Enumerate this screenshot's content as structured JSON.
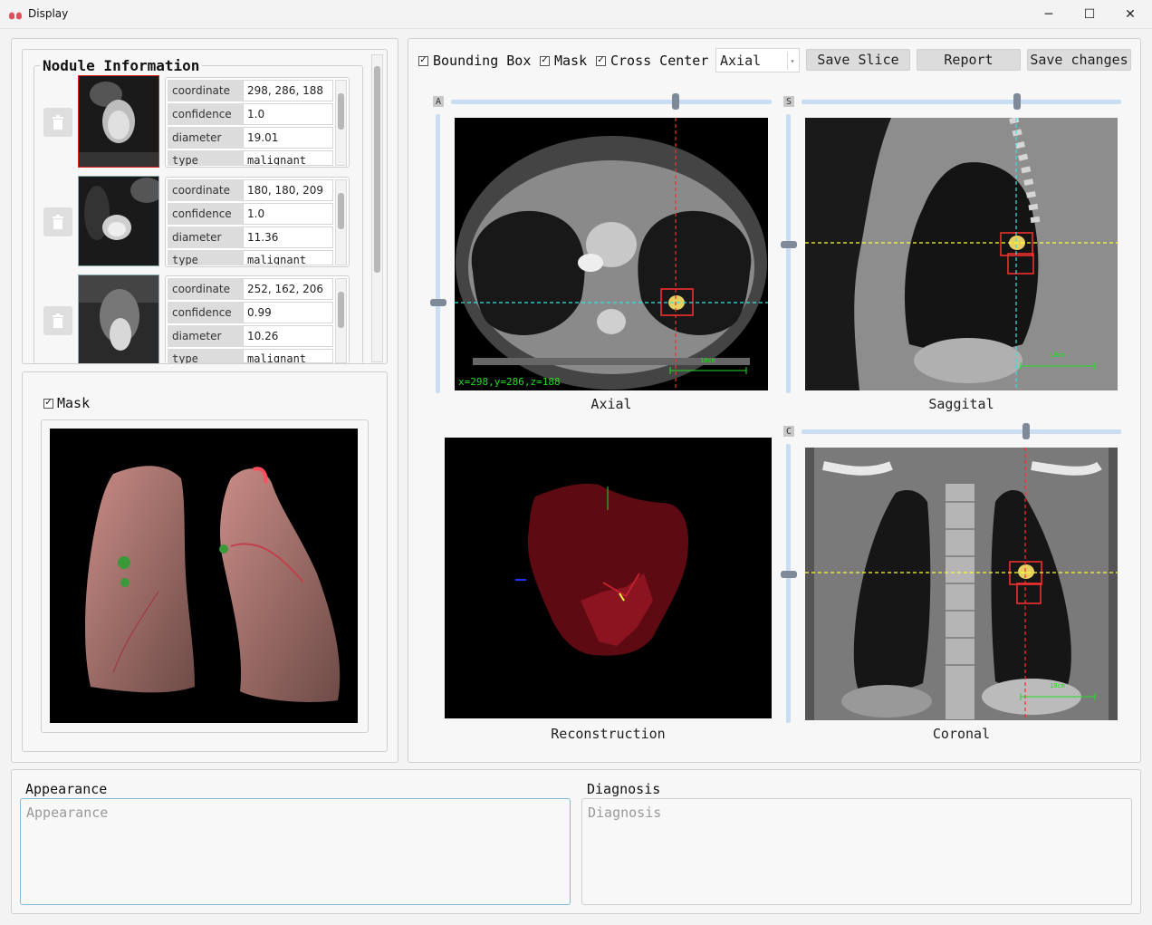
{
  "window": {
    "title": "Display",
    "min_glyph": "─",
    "max_glyph": "☐",
    "close_glyph": "✕"
  },
  "nodule_panel": {
    "title": "Nodule Information",
    "nodules": [
      {
        "coordinate": "298, 286, 188",
        "confidence": "1.0",
        "diameter": "19.01",
        "type": "malignant"
      },
      {
        "coordinate": "180, 180, 209",
        "confidence": "1.0",
        "diameter": "11.36",
        "type": "malignant"
      },
      {
        "coordinate": "252, 162, 206",
        "confidence": "0.99",
        "diameter": "10.26",
        "type": "malignant"
      }
    ],
    "field_labels": {
      "coordinate": "coordinate",
      "confidence": "confidence",
      "diameter": "diameter",
      "type": "type"
    }
  },
  "render3d": {
    "mask_label": "Mask",
    "mask_checked": true
  },
  "toolbar": {
    "bounding_box_label": "Bounding Box",
    "bounding_box_checked": true,
    "mask_label": "Mask",
    "mask_checked": true,
    "cross_center_label": "Cross Center",
    "cross_center_checked": true,
    "view_select_value": "Axial",
    "save_slice_label": "Save Slice",
    "report_label": "Report",
    "save_changes_label": "Save changes"
  },
  "views": {
    "axial": {
      "caption": "Axial",
      "slider_letter": "A",
      "coords_readout": "x=298,y=286,z=188",
      "scale_label": "10cm"
    },
    "saggital": {
      "caption": "Saggital",
      "slider_letter": "S",
      "scale_label": "10cm"
    },
    "reconstruction": {
      "caption": "Reconstruction"
    },
    "coronal": {
      "caption": "Coronal",
      "slider_letter": "C",
      "scale_label": "10cm"
    }
  },
  "report": {
    "appearance_label": "Appearance",
    "appearance_placeholder": "Appearance",
    "diagnosis_label": "Diagnosis",
    "diagnosis_placeholder": "Diagnosis"
  },
  "colors": {
    "accent": "#7fa7d8",
    "crosshair_red": "#ff2b2b",
    "crosshair_cyan": "#2ee6e6",
    "crosshair_yellow": "#ffff33",
    "scale_green": "#22dd22"
  }
}
